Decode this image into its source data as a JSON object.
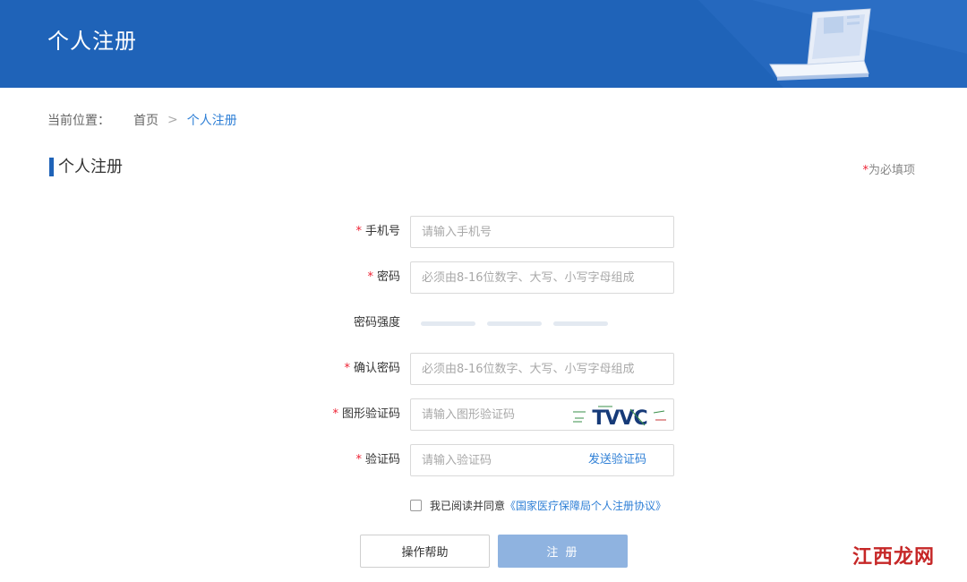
{
  "banner": {
    "title": "个人注册"
  },
  "breadcrumb": {
    "label": "当前位置：",
    "home": "首页",
    "separator": ">",
    "current": "个人注册"
  },
  "section": {
    "title": "个人注册",
    "required_note_star": "*",
    "required_note": "为必填项"
  },
  "form": {
    "phone": {
      "label": "手机号",
      "placeholder": "请输入手机号",
      "required": true
    },
    "password": {
      "label": "密码",
      "placeholder": "必须由8-16位数字、大写、小写字母组成",
      "required": true
    },
    "strength": {
      "label": "密码强度",
      "level": 0,
      "segments": 3
    },
    "confirm": {
      "label": "确认密码",
      "placeholder": "必须由8-16位数字、大写、小写字母组成",
      "required": true
    },
    "captcha": {
      "label": "图形验证码",
      "placeholder": "请输入图形验证码",
      "image_text": "TVVC",
      "required": true
    },
    "sms": {
      "label": "验证码",
      "placeholder": "请输入验证码",
      "send_label": "发送验证码",
      "required": true
    }
  },
  "agreement": {
    "checked": false,
    "text": "我已阅读并同意",
    "link": "《国家医疗保障局个人注册协议》"
  },
  "buttons": {
    "help": "操作帮助",
    "register": "注 册"
  },
  "watermark": "江西龙网",
  "colors": {
    "primary": "#1f63b8",
    "link": "#2e7fd6",
    "required": "#e22233",
    "register_disabled": "#8fb3e0"
  },
  "required_mark": "*"
}
